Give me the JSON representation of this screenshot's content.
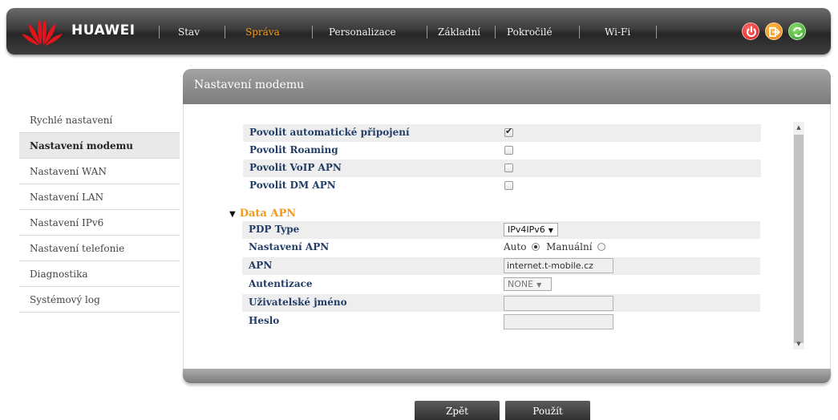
{
  "brand": {
    "name": "HUAWEI"
  },
  "nav": {
    "items": [
      {
        "label": "Stav",
        "active": false
      },
      {
        "label": "Správa",
        "active": true
      },
      {
        "label": "Personalizace",
        "active": false
      },
      {
        "label": "Základní",
        "active": false
      },
      {
        "label": "Pokročilé",
        "active": false
      },
      {
        "label": "Wi-Fi",
        "active": false
      }
    ]
  },
  "toolbar_icons": [
    "power-icon",
    "logout-icon",
    "refresh-icon"
  ],
  "sidebar": {
    "items": [
      {
        "label": "Rychlé nastavení"
      },
      {
        "label": "Nastavení modemu",
        "active": true
      },
      {
        "label": "Nastavení WAN"
      },
      {
        "label": "Nastavení LAN"
      },
      {
        "label": "Nastavení IPv6"
      },
      {
        "label": "Nastavení telefonie"
      },
      {
        "label": "Diagnostika"
      },
      {
        "label": "Systémový log"
      }
    ]
  },
  "panel": {
    "title": "Nastavení modemu"
  },
  "settings": {
    "auto_connect": {
      "label": "Povolit automatické připojení",
      "checked": true
    },
    "roaming": {
      "label": "Povolit Roaming",
      "checked": false
    },
    "voip_apn": {
      "label": "Povolit VoIP APN",
      "checked": false
    },
    "dm_apn": {
      "label": "Povolit DM APN",
      "checked": false
    }
  },
  "data_apn": {
    "section_title": "Data APN",
    "pdp_type": {
      "label": "PDP Type",
      "value": "IPv4IPv6"
    },
    "apn_setting": {
      "label": "Nastavení APN",
      "auto_label": "Auto",
      "manual_label": "Manuální",
      "selected": "Auto"
    },
    "apn": {
      "label": "APN",
      "value": "internet.t-mobile.cz"
    },
    "auth": {
      "label": "Autentizace",
      "value": "NONE"
    },
    "username": {
      "label": "Uživatelské jméno",
      "value": ""
    },
    "password": {
      "label": "Heslo",
      "value": ""
    }
  },
  "buttons": {
    "back": "Zpět",
    "apply": "Použít"
  },
  "colors": {
    "accent": "#f29a1c",
    "label": "#223d66"
  }
}
